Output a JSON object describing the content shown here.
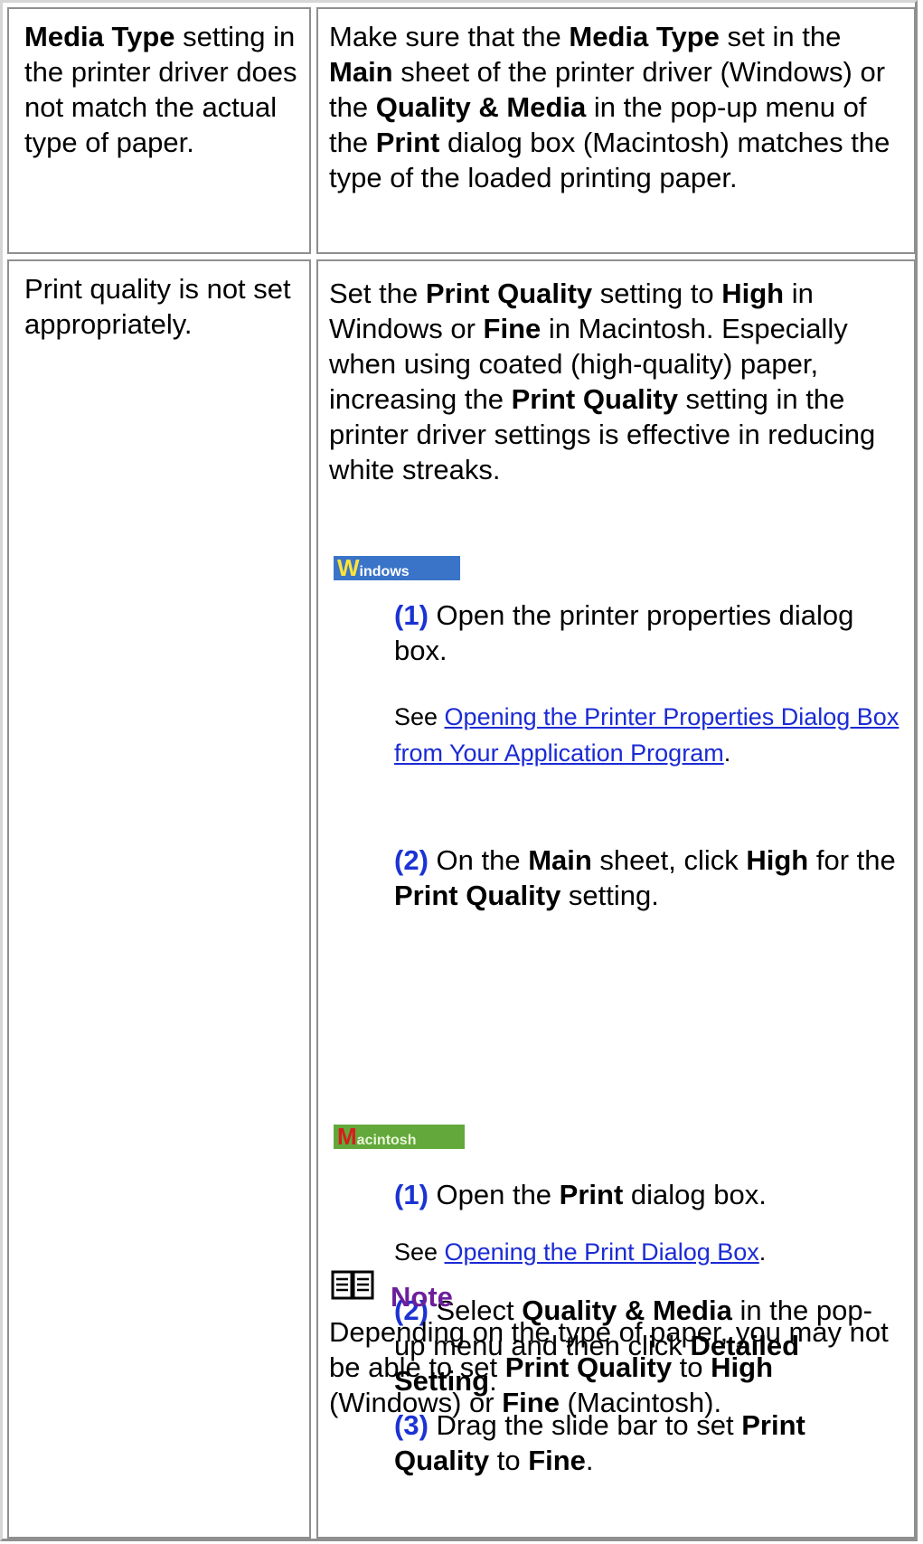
{
  "row1": {
    "cause": {
      "bold": "Media Type",
      "rest": " setting in the printer driver does not match the actual type of paper."
    },
    "solution": {
      "t1": "Make sure that the ",
      "b1": "Media Type",
      "t2": " set in the ",
      "b2": "Main",
      "t3": " sheet of the printer driver (Windows) or the ",
      "b3": "Quality & Media",
      "t4": " in the pop-up menu of the ",
      "b4": "Print",
      "t5": " dialog box (Macintosh) matches the type of the loaded printing paper."
    }
  },
  "row2": {
    "cause": "Print quality is not set appropriately.",
    "intro": {
      "t1": "Set the ",
      "b1": "Print Quality",
      "t2": " setting to ",
      "b2": "High",
      "t3": " in Windows or ",
      "b3": "Fine",
      "t4": " in Macintosh. Especially when using coated (high-quality) paper, increasing the ",
      "b4": "Print Quality",
      "t5": " setting in the printer driver settings is effective in reducing white streaks."
    },
    "windows": {
      "badge_first": "W",
      "badge_rest": "indows",
      "step1": {
        "num": "(1)",
        "text": " Open the printer properties dialog box."
      },
      "see1": {
        "prefix": "See ",
        "link": "Opening the Printer Properties Dialog Box from Your Application Program",
        "suffix": "."
      },
      "step2": {
        "num": "(2)",
        "t1": " On the ",
        "b1": "Main",
        "t2": " sheet, click ",
        "b2": "High",
        "t3": " for the ",
        "b3": "Print Quality",
        "t4": " setting."
      }
    },
    "macintosh": {
      "badge_first": "M",
      "badge_rest": "acintosh",
      "step1": {
        "num": "(1)",
        "t1": " Open the ",
        "b1": "Print",
        "t2": " dialog box."
      },
      "see1": {
        "prefix": "See ",
        "link": "Opening the Print Dialog Box",
        "suffix": "."
      },
      "step2": {
        "num": "(2)",
        "t1": " Select ",
        "b1": "Quality & Media",
        "t2": " in the pop-up menu and then click ",
        "b2": "Detailed Setting",
        "t3": "."
      },
      "step3": {
        "num": "(3)",
        "t1": " Drag the slide bar to set ",
        "b1": "Print Quality",
        "t2": " to ",
        "b2": "Fine",
        "t3": "."
      }
    },
    "note": {
      "icon": "book-icon",
      "title": "Note",
      "t1": "Depending on the type of paper, you may not be able to set ",
      "b1": "Print Quality",
      "t2": " to ",
      "b2": "High",
      "t3": " (Windows) or ",
      "b3": "Fine",
      "t4": " (Macintosh)."
    }
  }
}
